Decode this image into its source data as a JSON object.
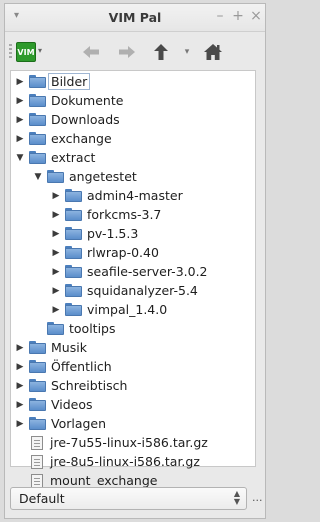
{
  "window": {
    "title": "VIM Pal",
    "menu_glyph": "▾",
    "minimize": "–",
    "maximize": "+",
    "close": "×"
  },
  "toolbar": {
    "vim_logo_text": "VIM",
    "vim_dropdown": "▾",
    "back": "back-arrow-icon",
    "forward": "forward-arrow-icon",
    "up": "up-arrow-icon",
    "history_dropdown": "▾",
    "home": "home-icon"
  },
  "tree": [
    {
      "label": "Bilder",
      "type": "folder",
      "depth": 0,
      "expanded": false,
      "focused": true
    },
    {
      "label": "Dokumente",
      "type": "folder",
      "depth": 0,
      "expanded": false
    },
    {
      "label": "Downloads",
      "type": "folder",
      "depth": 0,
      "expanded": false
    },
    {
      "label": "exchange",
      "type": "folder",
      "depth": 0,
      "expanded": false
    },
    {
      "label": "extract",
      "type": "folder",
      "depth": 0,
      "expanded": true
    },
    {
      "label": "angetestet",
      "type": "folder",
      "depth": 1,
      "expanded": true
    },
    {
      "label": "admin4-master",
      "type": "folder",
      "depth": 2,
      "expanded": false
    },
    {
      "label": "forkcms-3.7",
      "type": "folder",
      "depth": 2,
      "expanded": false
    },
    {
      "label": "pv-1.5.3",
      "type": "folder",
      "depth": 2,
      "expanded": false
    },
    {
      "label": "rlwrap-0.40",
      "type": "folder",
      "depth": 2,
      "expanded": false
    },
    {
      "label": "seafile-server-3.0.2",
      "type": "folder",
      "depth": 2,
      "expanded": false
    },
    {
      "label": "squidanalyzer-5.4",
      "type": "folder",
      "depth": 2,
      "expanded": false
    },
    {
      "label": "vimpal_1.4.0",
      "type": "folder",
      "depth": 2,
      "expanded": false
    },
    {
      "label": "tooltips",
      "type": "folder",
      "depth": 1,
      "leaf": true
    },
    {
      "label": "Musik",
      "type": "folder",
      "depth": 0,
      "expanded": false
    },
    {
      "label": "Öffentlich",
      "type": "folder",
      "depth": 0,
      "expanded": false
    },
    {
      "label": "Schreibtisch",
      "type": "folder",
      "depth": 0,
      "expanded": false
    },
    {
      "label": "Videos",
      "type": "folder",
      "depth": 0,
      "expanded": false
    },
    {
      "label": "Vorlagen",
      "type": "folder",
      "depth": 0,
      "expanded": false
    },
    {
      "label": "jre-7u55-linux-i586.tar.gz",
      "type": "file",
      "depth": 0
    },
    {
      "label": "jre-8u5-linux-i586.tar.gz",
      "type": "file",
      "depth": 0
    },
    {
      "label": "mount_exchange",
      "type": "file",
      "depth": 0
    }
  ],
  "footer": {
    "profile_value": "Default",
    "more_label": "..."
  },
  "colors": {
    "folder": "#5b8ecb",
    "nav_arrow": "#a8a8a8",
    "nav_strong": "#4a4a4a",
    "vim_green": "#2e9a2c"
  }
}
